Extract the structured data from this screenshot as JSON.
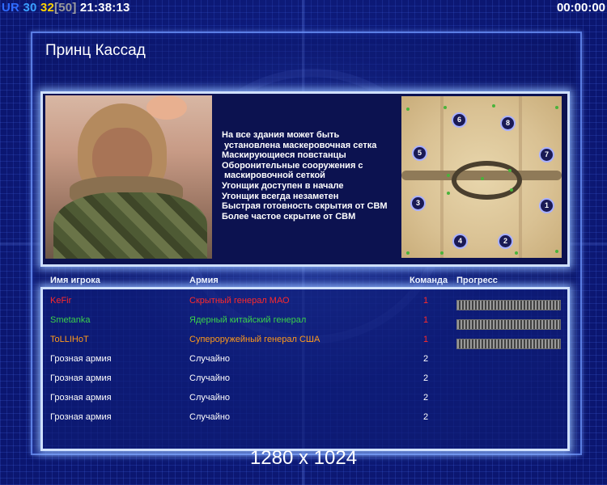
{
  "hud": {
    "ur": "UR",
    "money_left": "30",
    "money_right": "32",
    "bracket_open": "[",
    "limit": "50",
    "bracket_close": "]",
    "clock": "21:38:13",
    "timer": "00:00:00"
  },
  "general": {
    "title": "Принц Кассад",
    "description_lines": [
      "На все здания может быть",
      " установлена маскеровочная сетка",
      "Маскирующиеся повстанцы",
      "Оборонительные сооружения с",
      " маскировочной сеткой",
      "Угонщик доступен в начале",
      "Угонщик всегда незаметен",
      "Быстрая готовность скрытия от СВМ",
      "Более частое скрытие от СВМ"
    ]
  },
  "map": {
    "start_positions": [
      "1",
      "2",
      "3",
      "4",
      "5",
      "6",
      "7",
      "8"
    ]
  },
  "table": {
    "headers": {
      "player": "Имя игрока",
      "army": "Армия",
      "team": "Команда",
      "progress": "Прогресс"
    },
    "rows": [
      {
        "name": "KeFir",
        "army": "Скрытный генерал МАО",
        "team": "1",
        "color": "#ff2a2a",
        "progress": 1
      },
      {
        "name": "Smetanka",
        "army": "Ядерный китайский генерал",
        "team": "1",
        "color": "#3bd14a",
        "progress": 1
      },
      {
        "name": "ToLLIHoT",
        "army": "Супероружейный генерал США",
        "team": "1",
        "color": "#ff9a1a",
        "progress": 1
      },
      {
        "name": "Грозная армия",
        "army": "Случайно",
        "team": "2",
        "color": "#ffffff",
        "progress": 0
      },
      {
        "name": "Грозная армия",
        "army": "Случайно",
        "team": "2",
        "color": "#ffffff",
        "progress": 0
      },
      {
        "name": "Грозная армия",
        "army": "Случайно",
        "team": "2",
        "color": "#ffffff",
        "progress": 0
      },
      {
        "name": "Грозная армия",
        "army": "Случайно",
        "team": "2",
        "color": "#ffffff",
        "progress": 0
      }
    ]
  },
  "resolution": "1280 x 1024"
}
